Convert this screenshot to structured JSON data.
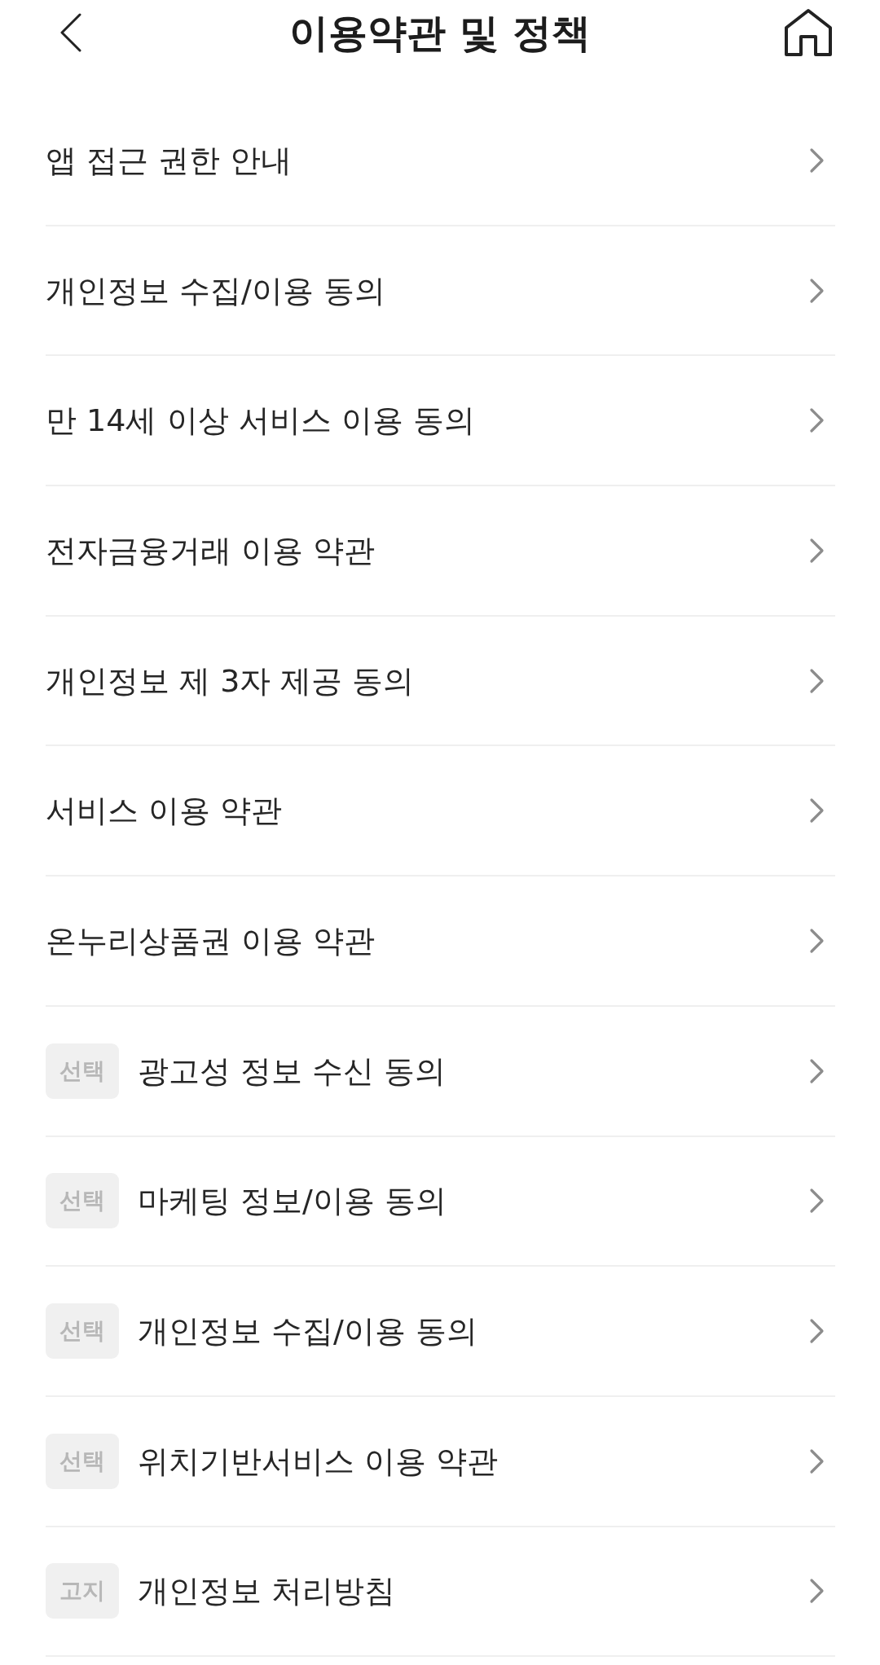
{
  "header": {
    "title": "이용약관 및 정책"
  },
  "items": [
    {
      "label": "앱 접근 권한 안내"
    },
    {
      "label": "개인정보 수집/이용 동의"
    },
    {
      "label": "만 14세 이상 서비스 이용 동의"
    },
    {
      "label": "전자금융거래 이용 약관"
    },
    {
      "label": "개인정보 제 3자 제공 동의"
    },
    {
      "label": "서비스 이용 약관"
    },
    {
      "label": "온누리상품권 이용 약관"
    },
    {
      "badge": "선택",
      "label": "광고성 정보 수신 동의"
    },
    {
      "badge": "선택",
      "label": "마케팅 정보/이용 동의"
    },
    {
      "badge": "선택",
      "label": "개인정보 수집/이용 동의"
    },
    {
      "badge": "선택",
      "label": "위치기반서비스 이용 약관"
    },
    {
      "badge": "고지",
      "label": "개인정보 처리방침"
    }
  ]
}
